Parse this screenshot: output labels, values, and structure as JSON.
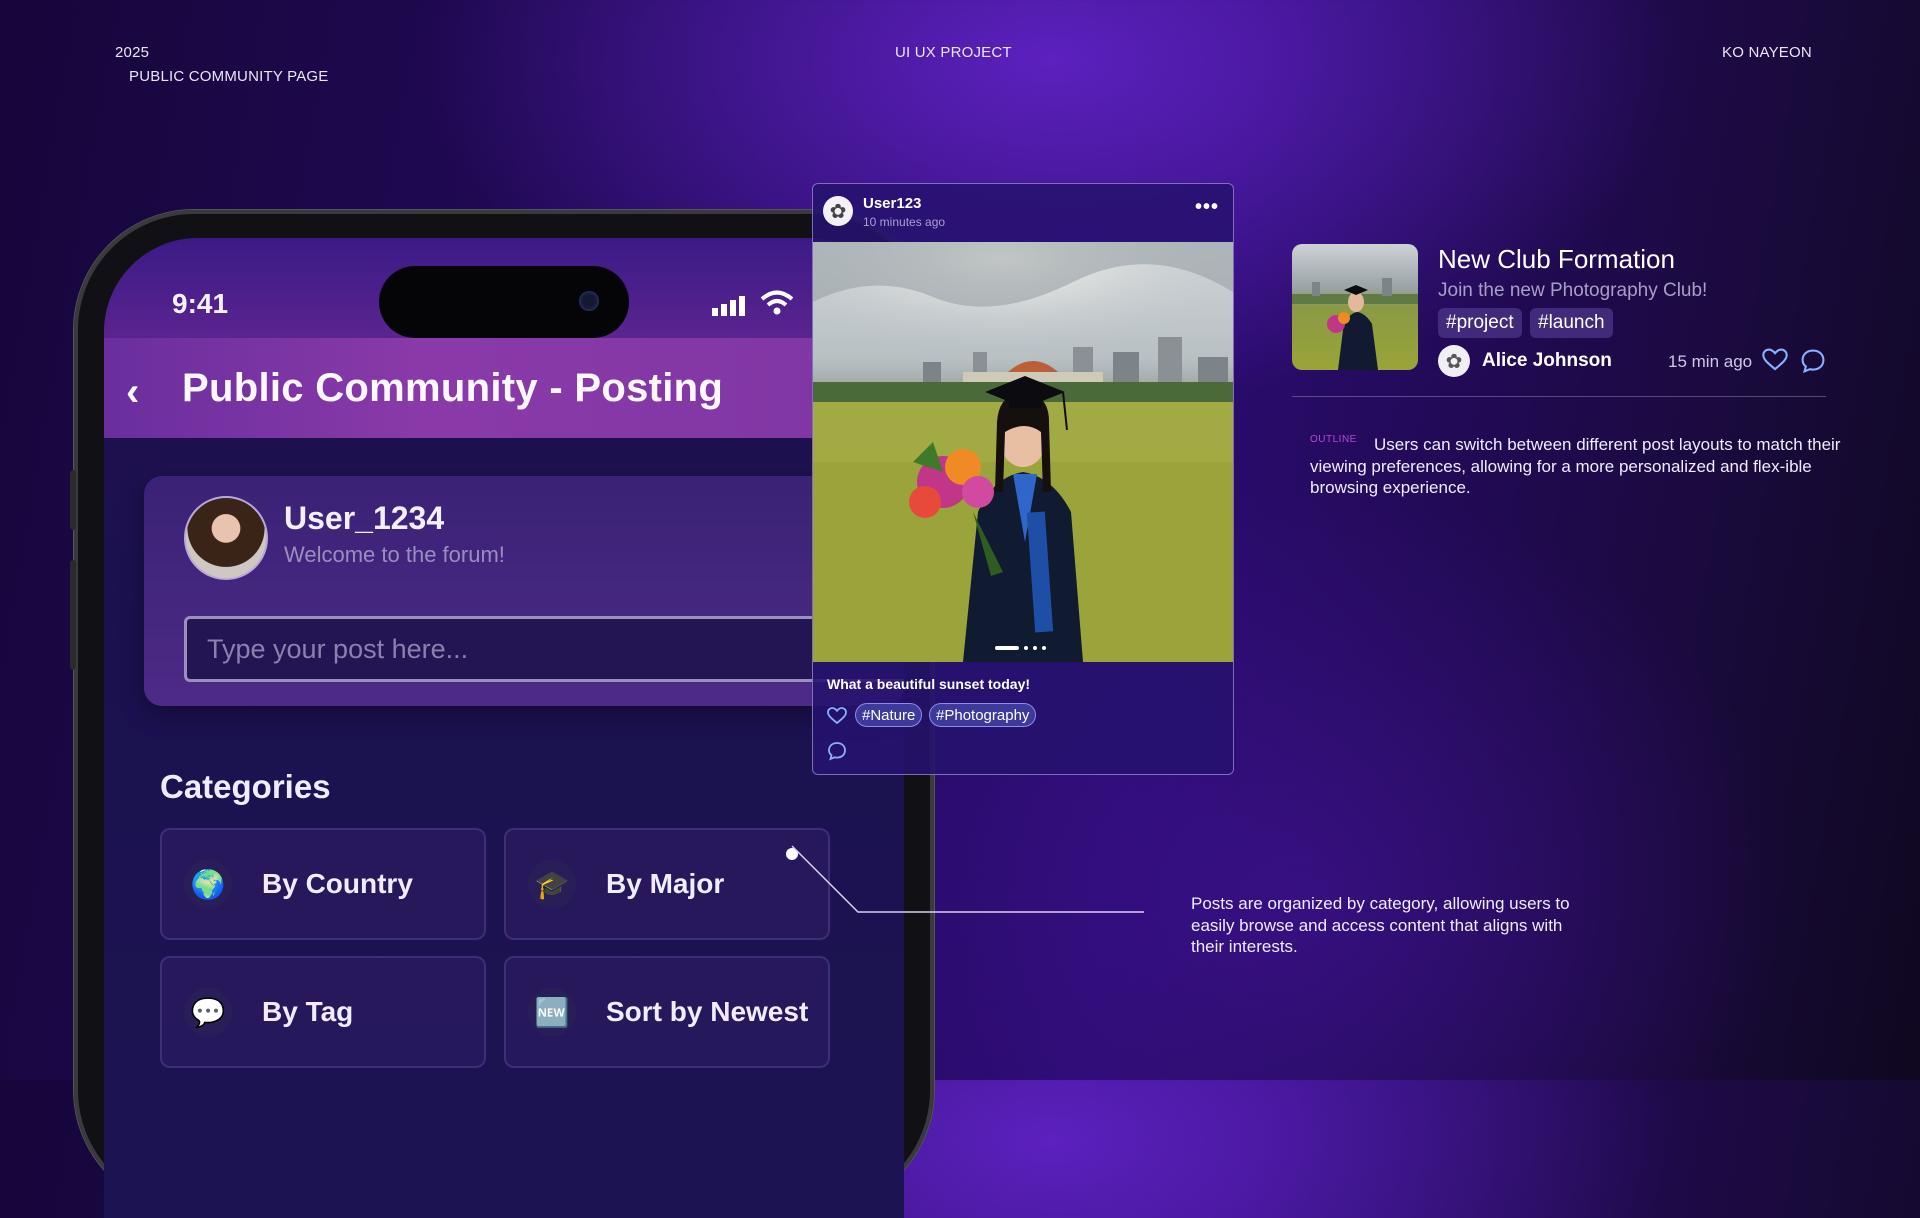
{
  "header": {
    "year": "2025",
    "page_label": "PUBLIC COMMUNITY PAGE",
    "project": "UI UX PROJECT",
    "author": "KO NAYEON"
  },
  "phone": {
    "time": "9:41",
    "nav_title": "Public Community - Posting",
    "user_name": "User_1234",
    "welcome": "Welcome to the forum!",
    "post_placeholder": "Type your post here...",
    "categories_title": "Categories",
    "categories": [
      {
        "label": "By Country",
        "icon": "globe-icon",
        "glyph": "🌍"
      },
      {
        "label": "By Major",
        "icon": "graduation-cap-icon",
        "glyph": "🎓"
      },
      {
        "label": "By Tag",
        "icon": "speech-bubble-icon",
        "glyph": "💬"
      },
      {
        "label": "Sort by Newest",
        "icon": "new-badge-icon",
        "glyph": "🆕"
      }
    ]
  },
  "post": {
    "user": "User123",
    "time": "10 minutes ago",
    "caption": "What a beautiful sunset today!",
    "tags": [
      "#Nature",
      "#Photography"
    ],
    "carousel_pages": 4,
    "carousel_active": 1
  },
  "club": {
    "title": "New Club Formation",
    "subtitle": "Join the new Photography Club!",
    "tags": [
      "#project",
      "#launch"
    ],
    "author": "Alice Johnson",
    "time": "15 min ago"
  },
  "annotations": {
    "outline_label": "OUTLINE",
    "outline_text": "Users can switch between different post layouts to match their viewing preferences, allowing for a more personalized and flex-ible browsing experience.",
    "category_note": "Posts are organized by category, allowing users to easily browse and access content that aligns with their interests."
  },
  "colors": {
    "accent_purple": "#7e36a4",
    "tag_pill": "#3d3a9c",
    "heart_outline": "#8ab0ff",
    "outline_label": "#b54ad0"
  }
}
